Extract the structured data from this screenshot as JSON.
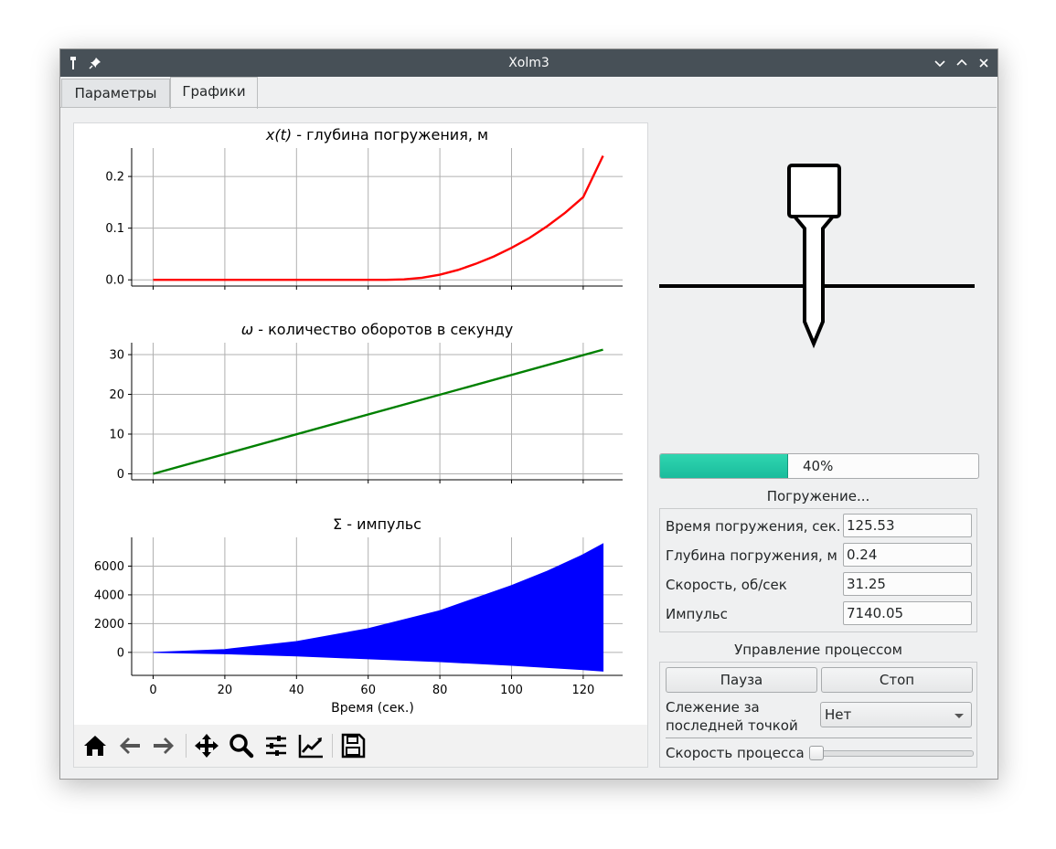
{
  "window": {
    "title": "Xolm3"
  },
  "tabs": [
    {
      "label": "Параметры",
      "active": false
    },
    {
      "label": "Графики",
      "active": true
    }
  ],
  "plots": {
    "xlabel": "Время (сек.)",
    "charts": [
      {
        "title_var": "x(t)",
        "title_rest": " - глубина погружения, м",
        "color": "#ff0000",
        "yticks": [
          "0.0",
          "0.1",
          "0.2"
        ]
      },
      {
        "title_var": "ω",
        "title_rest": " - количество оборотов в секунду",
        "color": "#008000",
        "yticks": [
          "0",
          "10",
          "20",
          "30"
        ]
      },
      {
        "title": "Σ - импульс",
        "color": "#0000ff",
        "yticks": [
          "0",
          "2000",
          "4000",
          "6000"
        ]
      }
    ],
    "xticks": [
      "0",
      "20",
      "40",
      "60",
      "80",
      "100",
      "120"
    ]
  },
  "chart_data": [
    {
      "type": "line",
      "title": "x(t) - глубина погружения, м",
      "xlabel": "",
      "ylabel": "",
      "xlim": [
        -6,
        131
      ],
      "ylim": [
        -0.012,
        0.255
      ],
      "series": [
        {
          "x": [
            0,
            10,
            20,
            30,
            40,
            50,
            60,
            65,
            70,
            75,
            80,
            85,
            90,
            95,
            100,
            105,
            110,
            115,
            120,
            125.53
          ],
          "y": [
            0,
            0,
            0,
            0,
            0,
            0,
            0,
            0,
            0.001,
            0.004,
            0.01,
            0.019,
            0.031,
            0.045,
            0.062,
            0.081,
            0.104,
            0.13,
            0.16,
            0.24
          ]
        }
      ]
    },
    {
      "type": "line",
      "title": "ω - количество оборотов в секунду",
      "xlabel": "",
      "ylabel": "",
      "xlim": [
        -6,
        131
      ],
      "ylim": [
        -1.5,
        33
      ],
      "series": [
        {
          "x": [
            0,
            125.53
          ],
          "y": [
            0,
            31.25
          ]
        }
      ]
    },
    {
      "type": "area",
      "title": "Σ - импульс",
      "xlabel": "Время (сек.)",
      "ylabel": "",
      "xlim": [
        -6,
        131
      ],
      "ylim": [
        -1600,
        8000
      ],
      "series": [
        {
          "x": [
            0,
            20,
            40,
            60,
            80,
            100,
            110,
            120,
            125.53
          ],
          "y": [
            0,
            200,
            750,
            1650,
            2900,
            4650,
            5650,
            6800,
            7550
          ]
        },
        {
          "x": [
            0,
            20,
            40,
            60,
            80,
            100,
            110,
            120,
            125.53
          ],
          "y": [
            0,
            -100,
            -250,
            -450,
            -650,
            -900,
            -1050,
            -1200,
            -1300
          ]
        }
      ]
    }
  ],
  "progress": {
    "value": 40,
    "text": "40%"
  },
  "status": "Погружение...",
  "info": [
    {
      "label": "Время погружения, сек.",
      "value": "125.53"
    },
    {
      "label": "Глубина погружения, м",
      "value": "0.24"
    },
    {
      "label": "Скорость, об/сек",
      "value": "31.25"
    },
    {
      "label": "Импульс",
      "value": "7140.05"
    }
  ],
  "control": {
    "title": "Управление процессом",
    "pause": "Пауза",
    "stop": "Стоп",
    "follow_label_1": "Слежение за",
    "follow_label_2": "последней точкой",
    "follow_value": "Нет",
    "speed_label": "Скорость процесса",
    "speed_level": 0
  }
}
